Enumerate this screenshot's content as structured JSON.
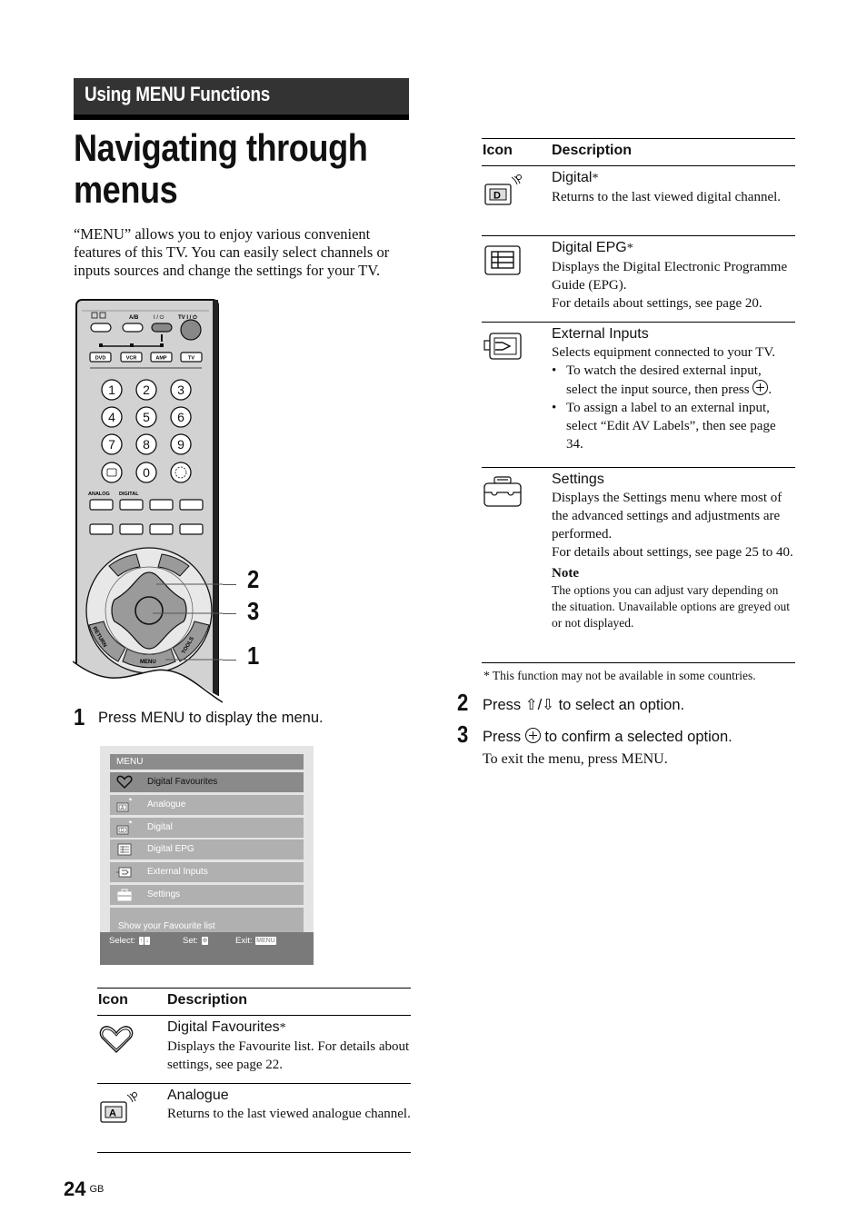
{
  "section_header": "Using MENU Functions",
  "page_title": "Navigating through menus",
  "intro": "“MENU” allows you to enjoy various convenient features of this TV. You can easily select channels or inputs sources and change the settings for your TV.",
  "remote": {
    "top_labels": [
      "A/B",
      "I / ⏻",
      "TV I / ⏻"
    ],
    "source_buttons": [
      "DVD",
      "VCR",
      "AMP",
      "TV"
    ],
    "number_keys": [
      "1",
      "2",
      "3",
      "4",
      "5",
      "6",
      "7",
      "8",
      "9",
      "0"
    ],
    "func_labels": [
      "ANALOG",
      "DIGITAL"
    ],
    "ring_labels": [
      "RETURN",
      "MENU",
      "TOOLS"
    ],
    "callouts": [
      "2",
      "3",
      "1"
    ]
  },
  "steps": [
    {
      "num": "1",
      "text": "Press MENU to display the menu."
    },
    {
      "num": "2",
      "text_before": "Press ",
      "arrows": "⇧/⇩",
      "text_after": " to select an option."
    },
    {
      "num": "3",
      "text_before": "Press ",
      "text_after": " to confirm a selected option.",
      "sub": "To exit the menu, press MENU."
    }
  ],
  "menu_screen": {
    "title": "MENU",
    "items": [
      {
        "label": "Digital Favourites",
        "icon": "heart-icon",
        "selected": true
      },
      {
        "label": "Analogue",
        "icon": "analogue-tv-icon",
        "selected": false
      },
      {
        "label": "Digital",
        "icon": "digital-tv-icon",
        "selected": false
      },
      {
        "label": "Digital EPG",
        "icon": "epg-list-icon",
        "selected": false
      },
      {
        "label": "External Inputs",
        "icon": "external-input-icon",
        "selected": false
      },
      {
        "label": "Settings",
        "icon": "toolbox-icon",
        "selected": false
      }
    ],
    "description": "Show your Favourite list",
    "footer": {
      "select_label": "Select:",
      "set_label": "Set:",
      "exit_label": "Exit:",
      "exit_key": "MENU"
    }
  },
  "table_headers": {
    "icon": "Icon",
    "description": "Description"
  },
  "left_table": [
    {
      "icon": "heart-icon",
      "title": "Digital Favourites",
      "asterisk": "*",
      "body": "Displays the Favourite list. For details about settings, see page 22."
    },
    {
      "icon": "analogue-tv-icon",
      "title": "Analogue",
      "asterisk": "",
      "body": "Returns to the last viewed analogue channel."
    }
  ],
  "right_table": [
    {
      "icon": "digital-tv-icon",
      "title": "Digital",
      "asterisk": "*",
      "body": "Returns to the last viewed digital channel."
    },
    {
      "icon": "epg-list-icon",
      "title": "Digital EPG",
      "asterisk": "*",
      "body": "Displays the Digital Electronic Programme Guide (EPG).",
      "body2": "For details about settings, see page 20."
    },
    {
      "icon": "external-input-icon",
      "title": "External Inputs",
      "asterisk": "",
      "body": "Selects equipment connected to your TV.",
      "bullets": [
        "To watch the desired external input, select the input source, then press",
        "To assign a label to an external input, select “Edit AV Labels”, then see page 34."
      ]
    },
    {
      "icon": "toolbox-icon",
      "title": "Settings",
      "asterisk": "",
      "body": "Displays the Settings menu where most of the advanced settings and adjustments are performed.",
      "body2": "For details about settings, see page 25 to 40.",
      "note_title": "Note",
      "note_body": "The options you can adjust vary depending on the situation. Unavailable options are greyed out or not displayed."
    }
  ],
  "footnote": "*  This function may not be available in some countries.",
  "page_number": "24",
  "page_region": "GB"
}
